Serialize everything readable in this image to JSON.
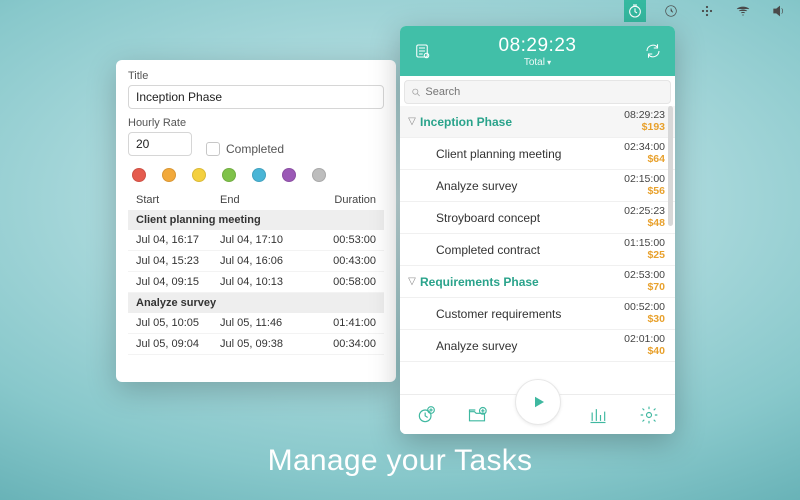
{
  "caption": "Manage your Tasks",
  "menubar": {
    "items": [
      "timer-app",
      "recent",
      "spotlight",
      "wifi",
      "volume"
    ]
  },
  "popover": {
    "header": {
      "timer": "08:29:23",
      "mode": "Total"
    },
    "search_placeholder": "Search",
    "groups": [
      {
        "name": "Inception Phase",
        "time": "08:29:23",
        "amount": "$193",
        "items": [
          {
            "name": "Client planning meeting",
            "time": "02:34:00",
            "amount": "$64"
          },
          {
            "name": "Analyze survey",
            "time": "02:15:00",
            "amount": "$56"
          },
          {
            "name": "Stroyboard concept",
            "time": "02:25:23",
            "amount": "$48"
          },
          {
            "name": "Completed contract",
            "time": "01:15:00",
            "amount": "$25"
          }
        ]
      },
      {
        "name": "Requirements Phase",
        "time": "02:53:00",
        "amount": "$70",
        "items": [
          {
            "name": "Customer requirements",
            "time": "00:52:00",
            "amount": "$30"
          },
          {
            "name": "Analyze survey",
            "time": "02:01:00",
            "amount": "$40"
          }
        ]
      }
    ]
  },
  "detail": {
    "title_label": "Title",
    "title_value": "Inception Phase",
    "rate_label": "Hourly Rate",
    "rate_value": "20",
    "completed_label": "Completed",
    "swatches": [
      "#e55b4e",
      "#f2a93b",
      "#f4d03f",
      "#7fc24a",
      "#4ab5d6",
      "#9b59b6",
      "#bdbdbd"
    ],
    "columns": {
      "start": "Start",
      "end": "End",
      "duration": "Duration"
    },
    "sessions": [
      {
        "group": "Client planning meeting",
        "rows": [
          {
            "start": "Jul 04, 16:17",
            "end": "Jul 04, 17:10",
            "duration": "00:53:00"
          },
          {
            "start": "Jul 04, 15:23",
            "end": "Jul 04, 16:06",
            "duration": "00:43:00"
          },
          {
            "start": "Jul 04, 09:15",
            "end": "Jul 04, 10:13",
            "duration": "00:58:00"
          }
        ]
      },
      {
        "group": "Analyze survey",
        "rows": [
          {
            "start": "Jul 05, 10:05",
            "end": "Jul 05, 11:46",
            "duration": "01:41:00"
          },
          {
            "start": "Jul 05, 09:04",
            "end": "Jul 05, 09:38",
            "duration": "00:34:00"
          }
        ]
      }
    ]
  }
}
